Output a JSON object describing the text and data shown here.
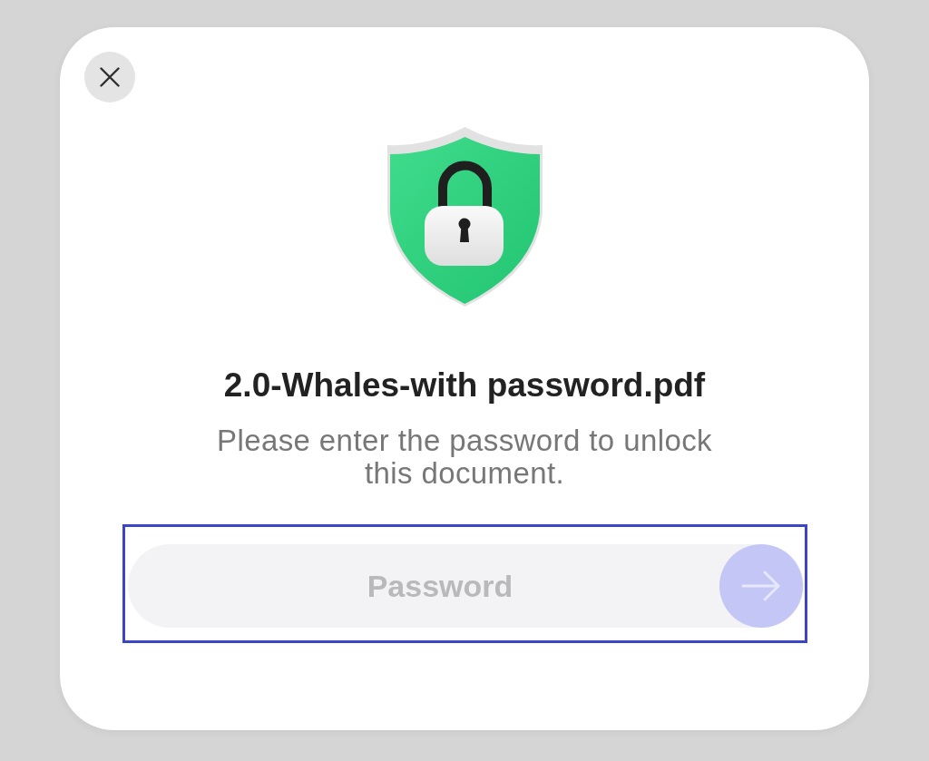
{
  "dialog": {
    "title": "2.0-Whales-with password.pdf",
    "message": "Please enter the password to unlock this document."
  },
  "password_field": {
    "placeholder": "Password",
    "highlighted": true
  },
  "submit_button": {
    "disabled": true
  }
}
